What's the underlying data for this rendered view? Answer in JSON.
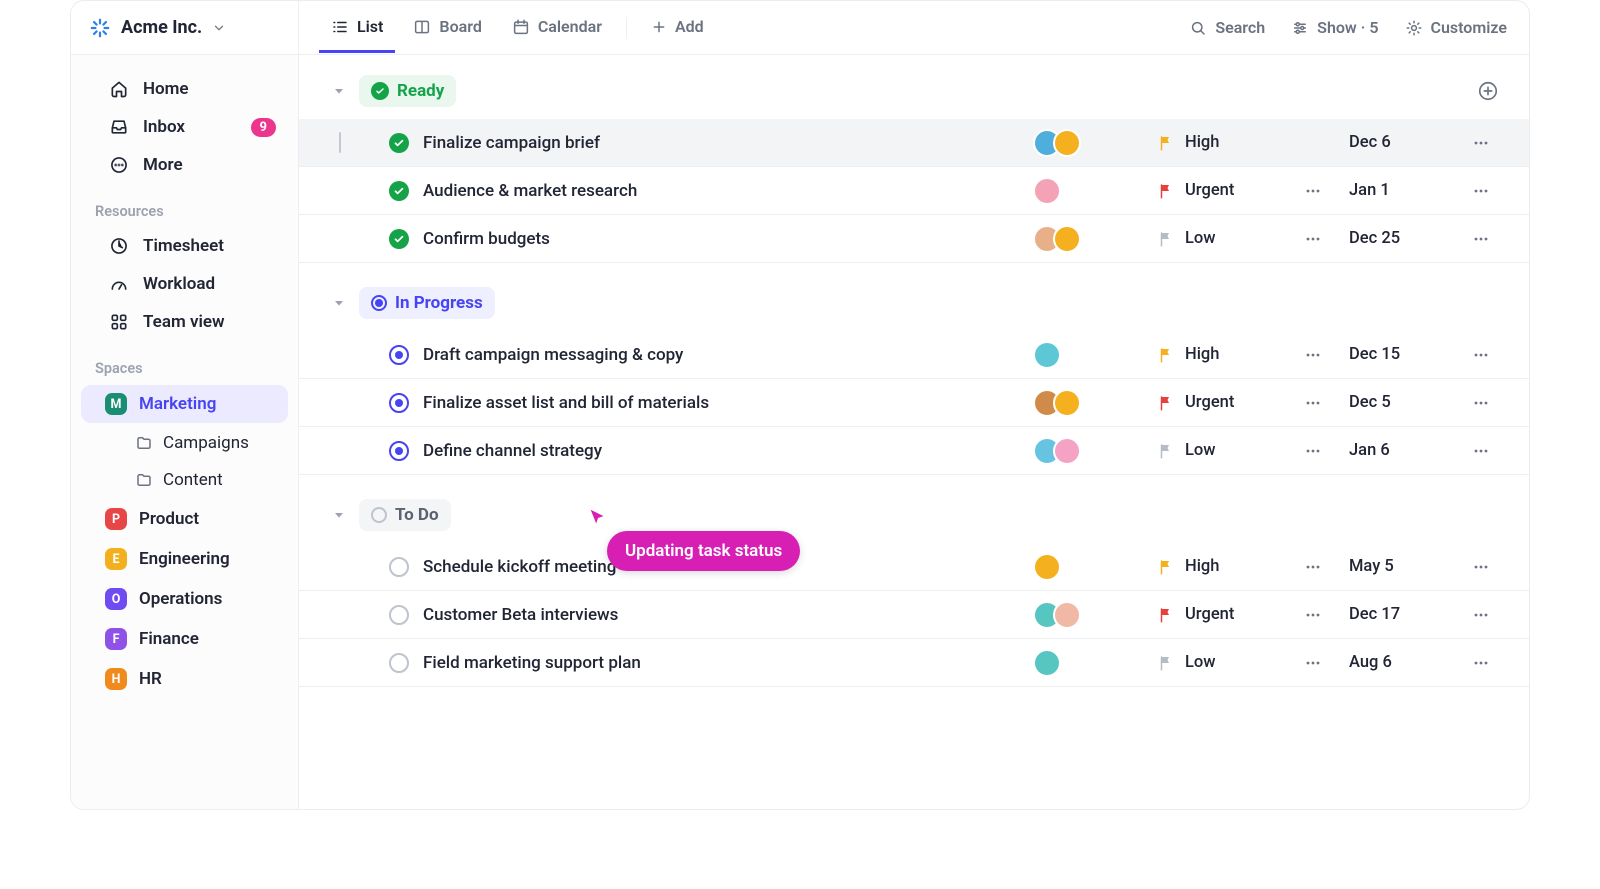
{
  "brand": {
    "name": "Acme Inc."
  },
  "top_views": {
    "list": "List",
    "board": "Board",
    "calendar": "Calendar",
    "add": "Add"
  },
  "top_actions": {
    "search": "Search",
    "show": "Show · 5",
    "customize": "Customize"
  },
  "sidebar": {
    "nav": {
      "home": "Home",
      "inbox": "Inbox",
      "inbox_count": "9",
      "more": "More"
    },
    "resources_label": "Resources",
    "resources": {
      "timesheet": "Timesheet",
      "workload": "Workload",
      "team_view": "Team view"
    },
    "spaces_label": "Spaces",
    "spaces": {
      "marketing": {
        "label": "Marketing",
        "badge": "M",
        "color": "#188f75"
      },
      "campaigns": "Campaigns",
      "content": "Content",
      "product": {
        "label": "Product",
        "badge": "P",
        "color": "#e64646"
      },
      "engineering": {
        "label": "Engineering",
        "badge": "E",
        "color": "#f2b01e"
      },
      "operations": {
        "label": "Operations",
        "badge": "O",
        "color": "#6f4bf2"
      },
      "finance": {
        "label": "Finance",
        "badge": "F",
        "color": "#8e52e8"
      },
      "hr": {
        "label": "HR",
        "badge": "H",
        "color": "#f08a1d"
      }
    }
  },
  "groups": {
    "ready": {
      "label": "Ready",
      "tasks": [
        {
          "title": "Finalize campaign brief",
          "prio": "High",
          "prio_color": "yellow",
          "date": "Dec 6",
          "highlight": true,
          "avatars": [
            "#4faedc",
            "#f4b01e"
          ]
        },
        {
          "title": "Audience & market research",
          "prio": "Urgent",
          "prio_color": "red",
          "date": "Jan 1",
          "avatars": [
            "#f4a3b6"
          ],
          "more": true
        },
        {
          "title": "Confirm budgets",
          "prio": "Low",
          "prio_color": "gray",
          "date": "Dec 25",
          "avatars": [
            "#e8b089",
            "#f4b01e"
          ],
          "more": true
        }
      ]
    },
    "in_progress": {
      "label": "In Progress",
      "tasks": [
        {
          "title": "Draft campaign messaging & copy",
          "prio": "High",
          "prio_color": "yellow",
          "date": "Dec 15",
          "avatars": [
            "#5ec7d6"
          ],
          "more": true
        },
        {
          "title": "Finalize asset list and bill of materials",
          "prio": "Urgent",
          "prio_color": "red",
          "date": "Dec 5",
          "avatars": [
            "#d08b4a",
            "#f4b01e"
          ],
          "more": true
        },
        {
          "title": "Define channel strategy",
          "prio": "Low",
          "prio_color": "gray",
          "date": "Jan 6",
          "avatars": [
            "#66c4e0",
            "#f4a3c5"
          ],
          "more": true
        }
      ]
    },
    "todo": {
      "label": "To Do",
      "tasks": [
        {
          "title": "Schedule kickoff meeting",
          "prio": "High",
          "prio_color": "yellow",
          "date": "May 5",
          "avatars": [
            "#f4b01e"
          ],
          "more": true
        },
        {
          "title": "Customer Beta interviews",
          "prio": "Urgent",
          "prio_color": "red",
          "date": "Dec 17",
          "avatars": [
            "#57c6c1",
            "#f1b8a5"
          ],
          "more": true
        },
        {
          "title": "Field marketing support plan",
          "prio": "Low",
          "prio_color": "gray",
          "date": "Aug 6",
          "avatars": [
            "#57c6c1"
          ],
          "more": true
        }
      ]
    }
  },
  "tooltip": {
    "text": "Updating task status"
  }
}
